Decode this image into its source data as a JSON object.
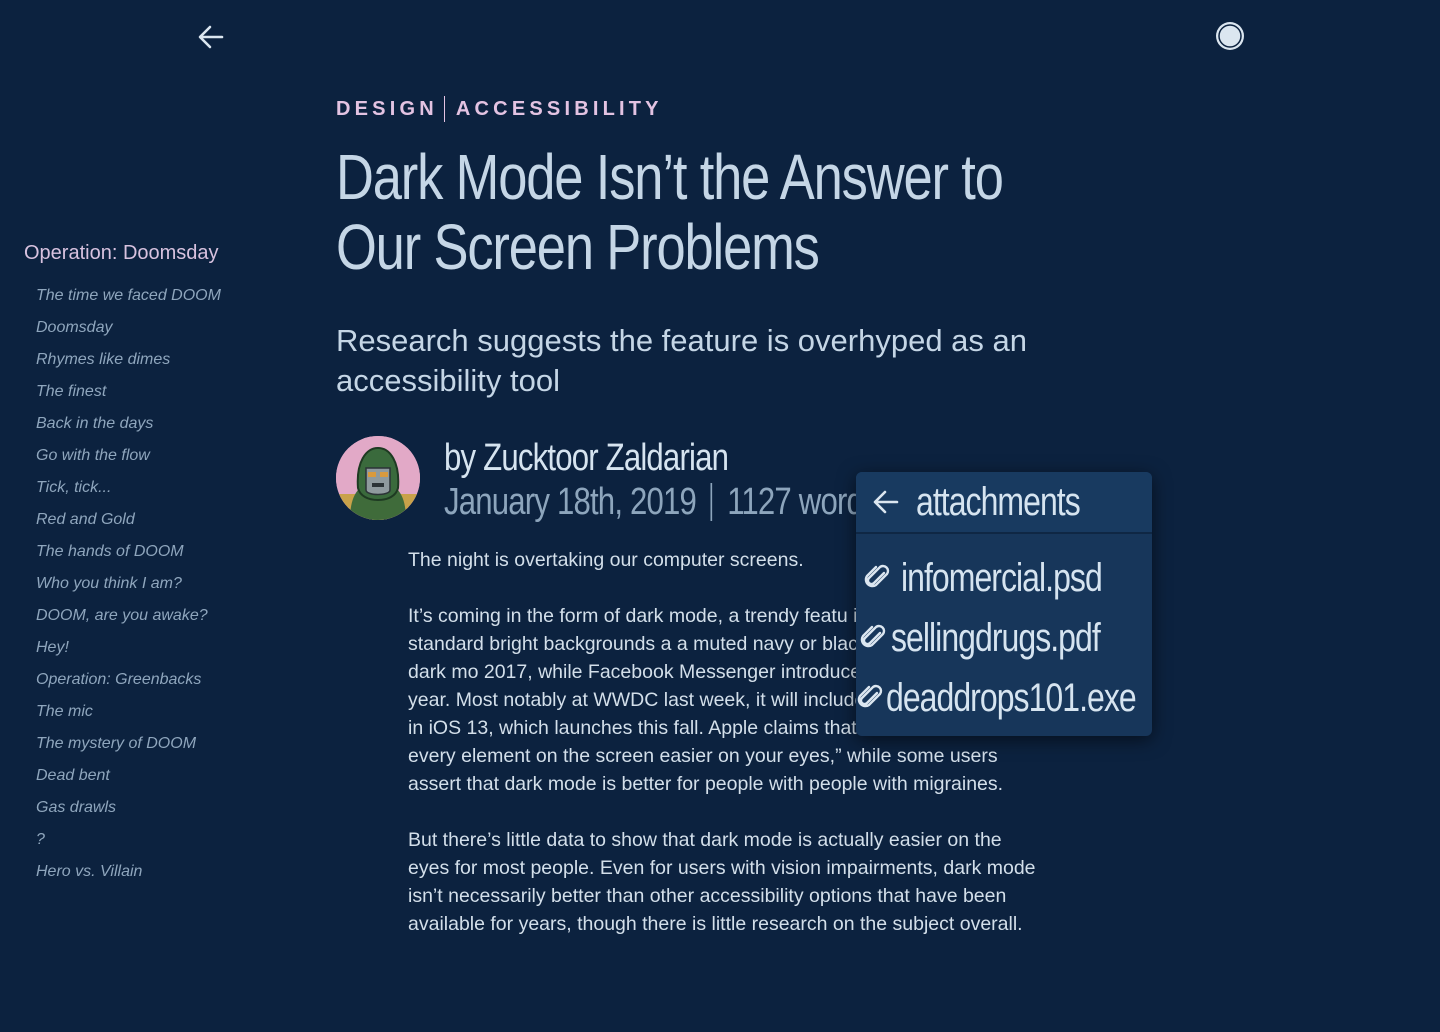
{
  "nav": {
    "back_icon": "arrow-left-icon",
    "theme_icon": "half-moon-contrast-icon"
  },
  "toc": {
    "title": "Operation: Doomsday",
    "items": [
      "The time we faced DOOM",
      "Doomsday",
      "Rhymes like dimes",
      "The finest",
      "Back in the days",
      "Go with the flow",
      "Tick, tick...",
      "Red and Gold",
      "The hands of DOOM",
      "Who you think I am?",
      "DOOM, are you awake?",
      "Hey!",
      "Operation: Greenbacks",
      "The mic",
      "The mystery of DOOM",
      "Dead bent",
      "Gas drawls",
      "?",
      "Hero vs. Villain"
    ]
  },
  "article": {
    "tags": [
      "DESIGN",
      "ACCESSIBILITY"
    ],
    "title_line1": "Dark Mode Isn’t the Answer to",
    "title_line2": "Our Screen Problems",
    "subtitle": "Research suggests the feature is overhyped as an accessibility tool",
    "author": "by Zucktoor Zaldarian",
    "date": "January 18th, 2019",
    "words": "1127 words",
    "paragraphs": [
      "The night is overtaking our computer screens.",
      "It’s coming in the form of dark mode, a trendy featu industry in which the standard bright backgrounds a a muted navy or black. Twitter launched its dark mo 2017, while Facebook Messenger introduced a dar April of this year. Most notably at WWDC last week, it will include a dark mode option in iOS 13, which launches this fall. Apple claims that dark mode will “make every element on the screen easier on your eyes,” while some users assert that dark mode is better for people with people with migraines.",
      "But there’s little data to show that dark mode is actually easier on the eyes for most people. Even for users with vision impairments, dark mode isn’t necessarily better than other accessibility options that have been available for years, though there is little research on the subject overall."
    ]
  },
  "attachments": {
    "header": "attachments",
    "items": [
      "infomercial.psd",
      "sellingdrugs.pdf",
      "deaddrops101.exe"
    ]
  },
  "colors": {
    "background": "#0c223f",
    "kicker": "#e3c3e2",
    "popup": "#17365a"
  }
}
